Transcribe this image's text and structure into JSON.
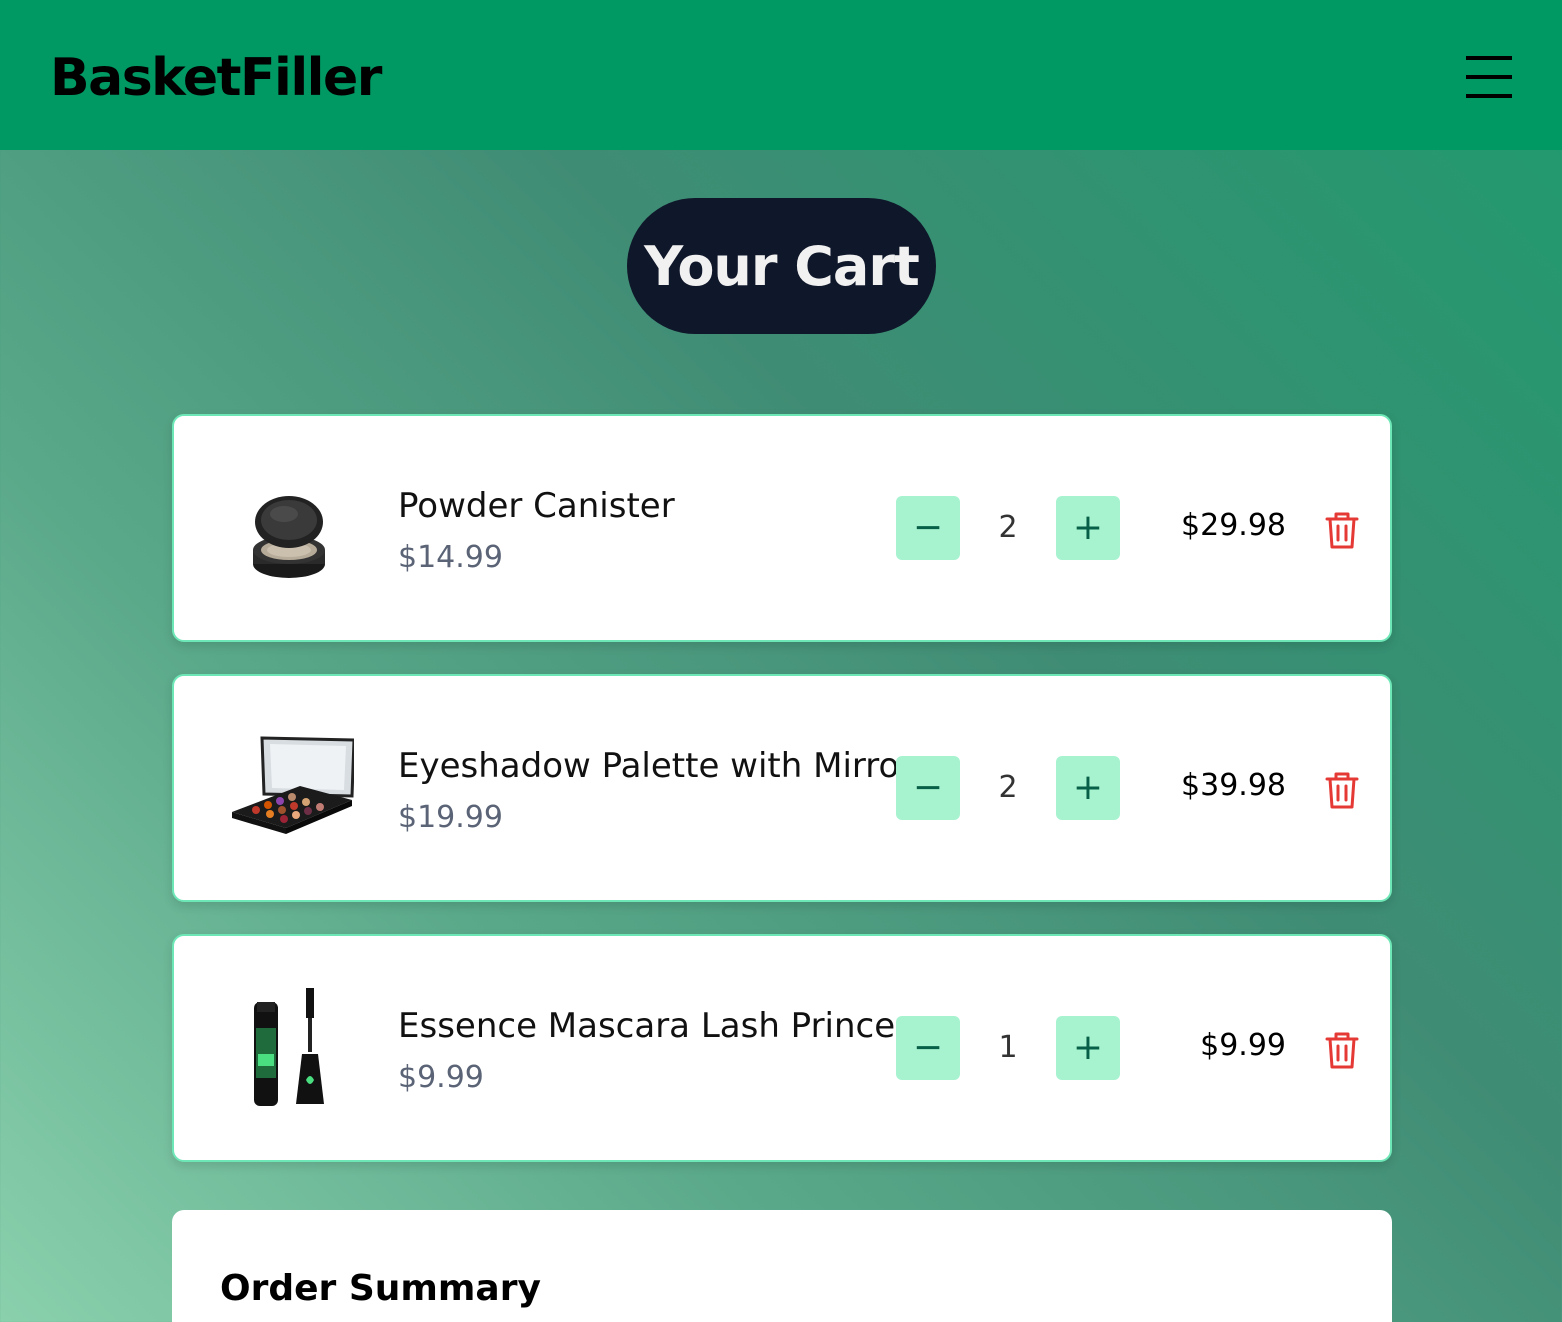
{
  "header": {
    "brand": "BasketFiller",
    "menu_icon": "hamburger-menu-icon"
  },
  "page": {
    "title": "Your Cart"
  },
  "colors": {
    "header_bg": "#009863",
    "title_bg": "#0f172a",
    "qty_button_bg": "#a7f3d0",
    "card_border": "#6ee7b7",
    "delete_icon": "#e53935"
  },
  "cart": {
    "items": [
      {
        "name": "Powder Canister",
        "unit_price": "$14.99",
        "quantity": "2",
        "minus_label": "−",
        "plus_label": "+",
        "total": "$29.98",
        "image_icon": "powder-compact-image",
        "delete_icon": "trash-icon"
      },
      {
        "name": "Eyeshadow Palette with Mirror",
        "unit_price": "$19.99",
        "quantity": "2",
        "minus_label": "−",
        "plus_label": "+",
        "total": "$39.98",
        "image_icon": "eyeshadow-palette-image",
        "delete_icon": "trash-icon"
      },
      {
        "name": "Essence Mascara Lash Princess",
        "unit_price": "$9.99",
        "quantity": "1",
        "minus_label": "−",
        "plus_label": "+",
        "total": "$9.99",
        "image_icon": "mascara-image",
        "delete_icon": "trash-icon"
      }
    ]
  },
  "summary": {
    "title": "Order Summary"
  }
}
